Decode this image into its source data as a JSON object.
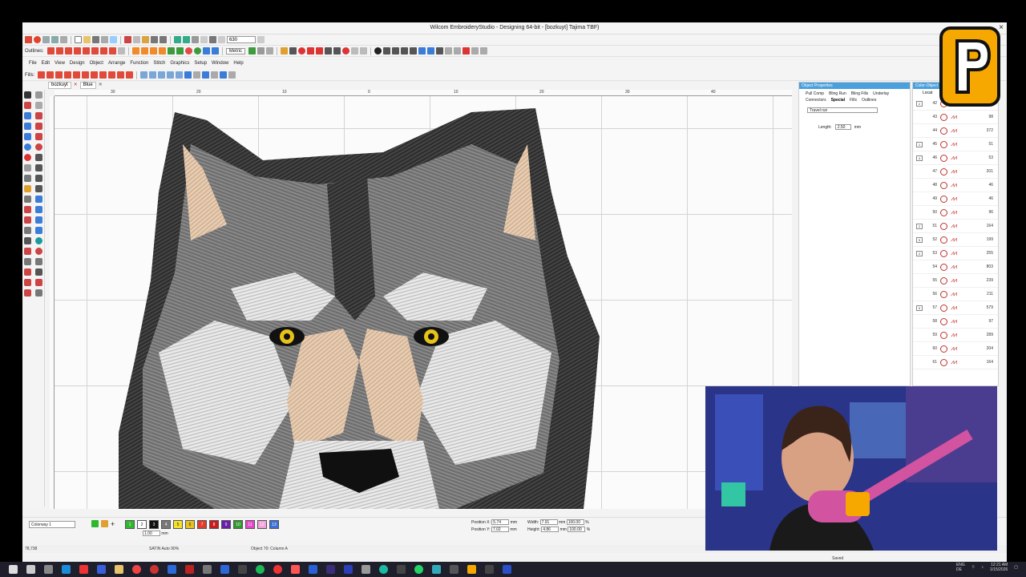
{
  "window": {
    "title": "Wilcom EmbroideryStudio - Designing 64-bit - [bozkuyt]      Tajima TBF)",
    "close_glyph": "×"
  },
  "toolbar1": {
    "zoom_value": "630"
  },
  "toolbar2": {
    "label": "Outlines:",
    "metric_select": "Metric"
  },
  "menu": [
    "File",
    "Edit",
    "View",
    "Design",
    "Object",
    "Arrange",
    "Function",
    "Stitch",
    "Graphics",
    "Setup",
    "Window",
    "Help"
  ],
  "fills_label": "Fills:",
  "doc_tabs": [
    "bozkuyt",
    "Blue"
  ],
  "ruler": {
    "ticks": [
      "30",
      "20",
      "10",
      "0",
      "10",
      "20",
      "30",
      "40"
    ]
  },
  "object_properties": {
    "title": "Object Properties",
    "tabs": [
      "Pull Comp",
      "Bling Run",
      "Bling Fills",
      "Underlay",
      "Connectors",
      "Special",
      "Fills",
      "Outlines"
    ],
    "travel_select": "Travel run",
    "length_label": "Length:",
    "length_value": "2.50",
    "length_unit": "mm"
  },
  "color_object": {
    "title": "Color-Object",
    "header": "Locat",
    "rows": [
      {
        "n": "42",
        "c": "7",
        "mark": "2"
      },
      {
        "n": "43",
        "c": "98",
        "mark": ""
      },
      {
        "n": "44",
        "c": "372",
        "mark": ""
      },
      {
        "n": "45",
        "c": "51",
        "mark": "1"
      },
      {
        "n": "46",
        "c": "53",
        "mark": "4"
      },
      {
        "n": "47",
        "c": "201",
        "mark": ""
      },
      {
        "n": "48",
        "c": "46",
        "mark": ""
      },
      {
        "n": "49",
        "c": "46",
        "mark": ""
      },
      {
        "n": "50",
        "c": "96",
        "mark": ""
      },
      {
        "n": "51",
        "c": "164",
        "mark": "2"
      },
      {
        "n": "52",
        "c": "199",
        "mark": "5"
      },
      {
        "n": "53",
        "c": "255",
        "mark": "2"
      },
      {
        "n": "54",
        "c": "803",
        "mark": ""
      },
      {
        "n": "55",
        "c": "239",
        "mark": ""
      },
      {
        "n": "56",
        "c": "211",
        "mark": ""
      },
      {
        "n": "57",
        "c": "579",
        "mark": "5"
      },
      {
        "n": "58",
        "c": "97",
        "mark": ""
      },
      {
        "n": "59",
        "c": "289",
        "mark": ""
      },
      {
        "n": "60",
        "c": "204",
        "mark": ""
      },
      {
        "n": "61",
        "c": "164",
        "mark": ""
      }
    ]
  },
  "bottom": {
    "colorway": "Colorway 1",
    "chips": [
      {
        "label": "1",
        "color": "#2db82d"
      },
      {
        "label": "2",
        "color": "#ffffff"
      },
      {
        "label": "3",
        "color": "#111111"
      },
      {
        "label": "4",
        "color": "#777777"
      },
      {
        "label": "5",
        "color": "#f4e02a"
      },
      {
        "label": "6",
        "color": "#e7c21f"
      },
      {
        "label": "7",
        "color": "#e23b2b"
      },
      {
        "label": "8",
        "color": "#c91d1d"
      },
      {
        "label": "9",
        "color": "#6a1fa8"
      },
      {
        "label": "10",
        "color": "#2f9a2f"
      },
      {
        "label": "11",
        "color": "#e347c9"
      },
      {
        "label": "12",
        "color": "#f1a0d9"
      },
      {
        "label": "13",
        "color": "#3b6ed9"
      }
    ],
    "position_x_label": "Position X:",
    "position_x": "5.74",
    "position_y_label": "Position Y:",
    "position_y": "7.02",
    "width_label": "Width:",
    "width": "7.91",
    "height_label": "Height:",
    "height": "4.86",
    "scale_w": "100.00",
    "scale_h": "100.00",
    "unit_mm": "mm",
    "unit_pct": "%",
    "stitch_len": "1.00"
  },
  "status": {
    "coords": "78,738",
    "stitch": "SATIN Auto 90%",
    "object": "Object 70: Column A",
    "saved": "Saved"
  },
  "taskbar": {
    "lang": "ENG\nDE",
    "time": "12:21 AM",
    "date": "1/15/2026"
  }
}
